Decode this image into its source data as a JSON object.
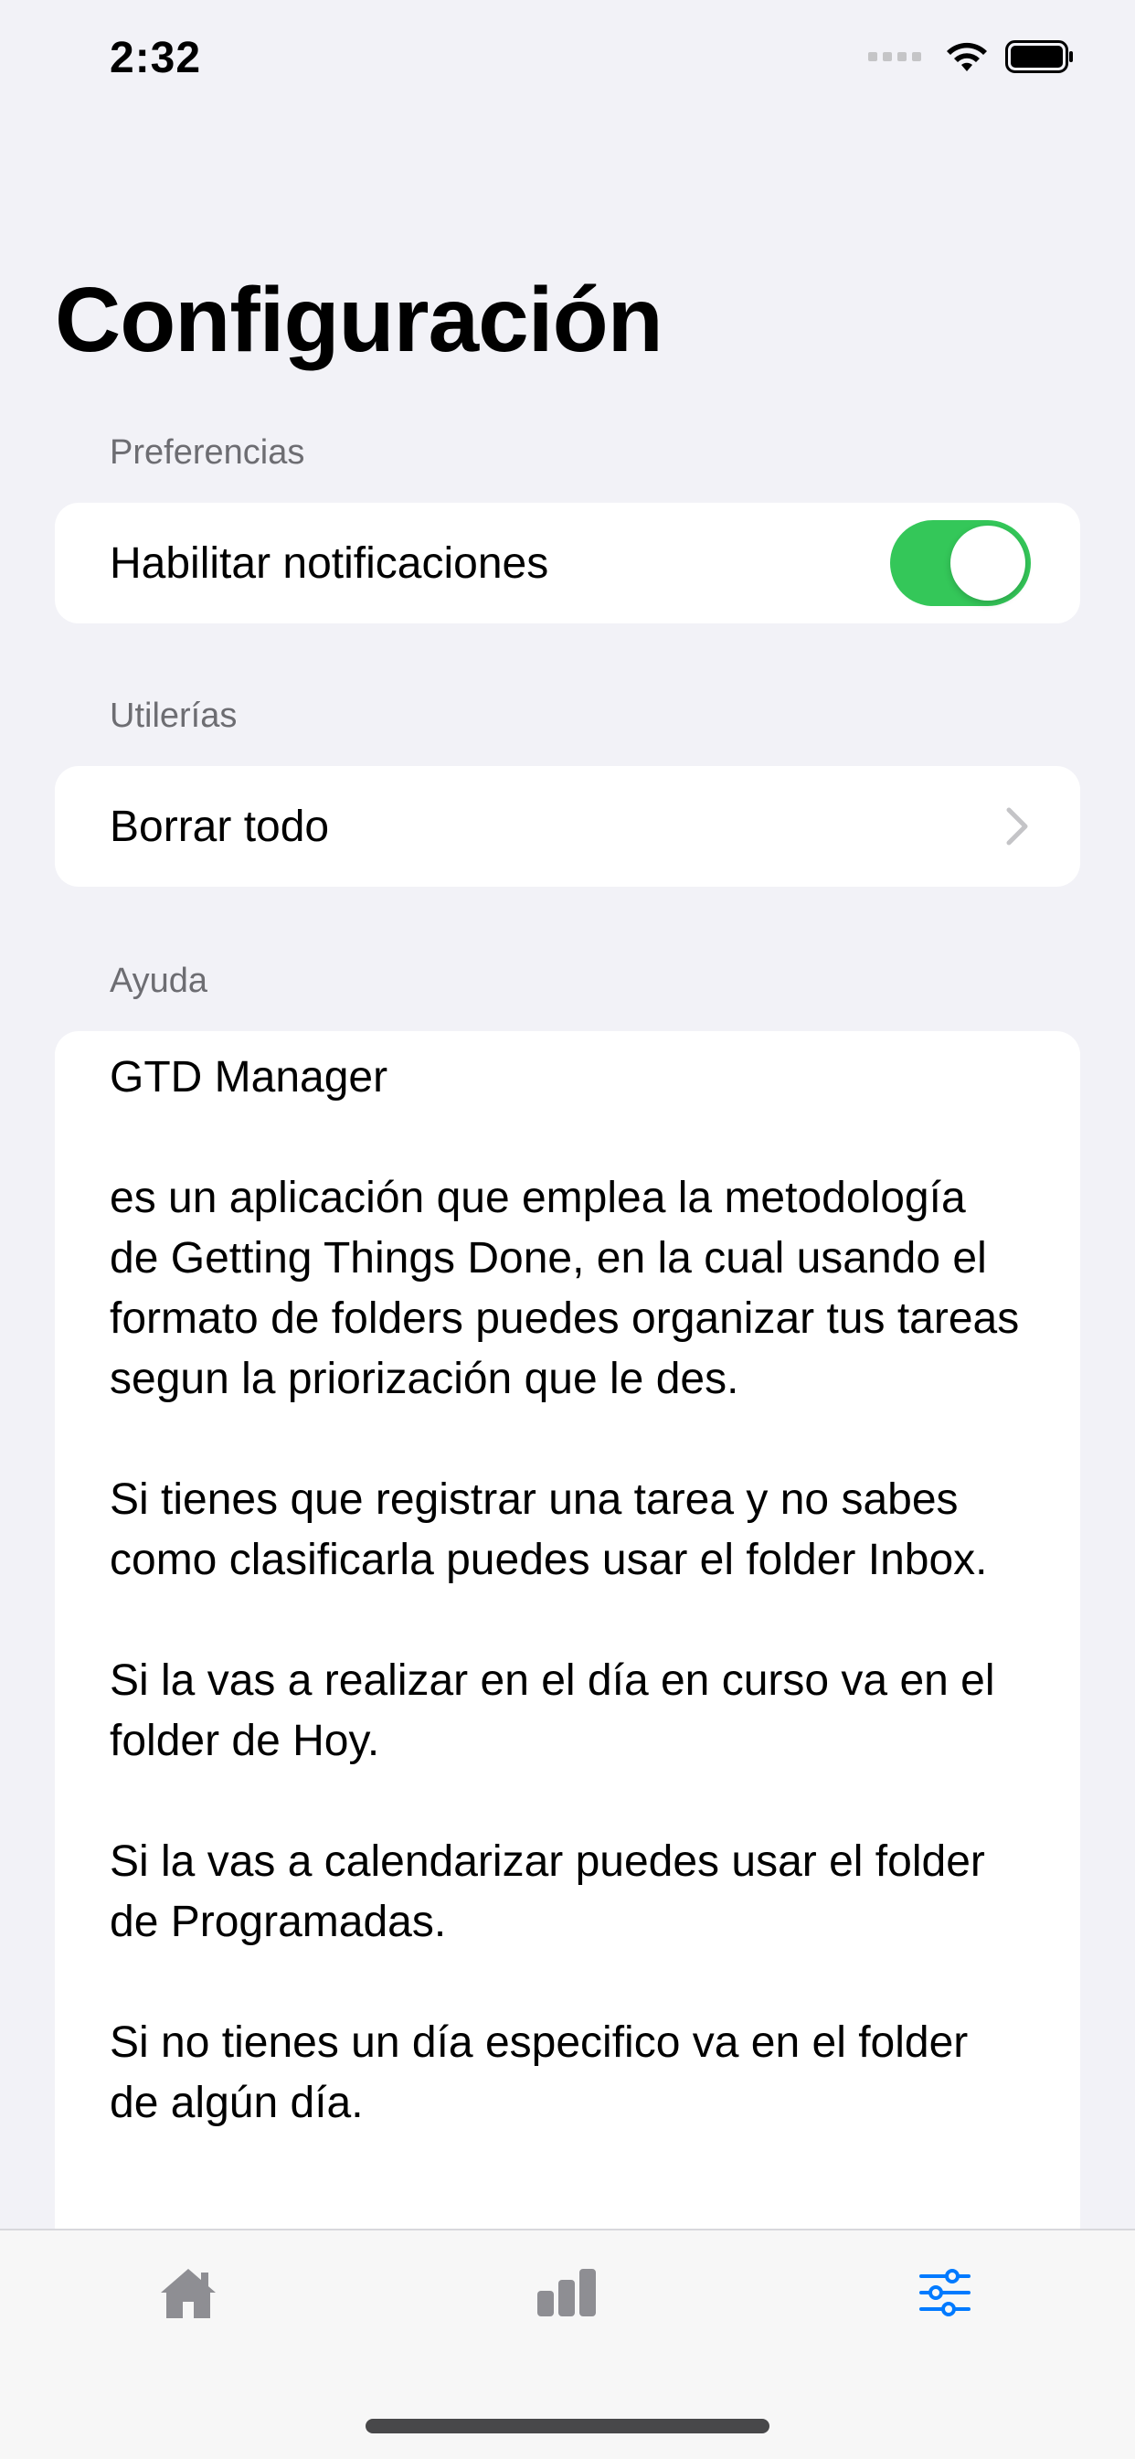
{
  "status_bar": {
    "time": "2:32"
  },
  "page": {
    "title": "Configuración"
  },
  "sections": {
    "preferences": {
      "header": "Preferencias",
      "notifications_label": "Habilitar notificaciones",
      "notifications_enabled": true
    },
    "utilities": {
      "header": "Utilerías",
      "delete_all_label": "Borrar todo"
    },
    "help": {
      "header": "Ayuda",
      "paragraphs": [
        "GTD Manager",
        "es un aplicación que emplea la metodología de Getting Things Done, en la cual usando el formato de folders puedes organizar tus tareas segun la priorización que le des.",
        "Si tienes que registrar una tarea y no sabes como clasificarla puedes usar el folder Inbox.",
        "Si la vas a realizar en el día en curso va en el folder de Hoy.",
        "Si la vas a calendarizar puedes usar el folder de Programadas.",
        "Si no tienes un día especifico va en el folder de algún día."
      ]
    }
  },
  "tab_bar": {
    "tabs": [
      {
        "name": "home",
        "icon": "house-icon",
        "active": false
      },
      {
        "name": "stats",
        "icon": "bar-chart-icon",
        "active": false
      },
      {
        "name": "settings",
        "icon": "sliders-icon",
        "active": true
      }
    ]
  },
  "colors": {
    "background": "#f2f2f7",
    "toggle_on": "#34c759",
    "tab_active": "#007aff",
    "tab_inactive": "#8e8e93"
  }
}
